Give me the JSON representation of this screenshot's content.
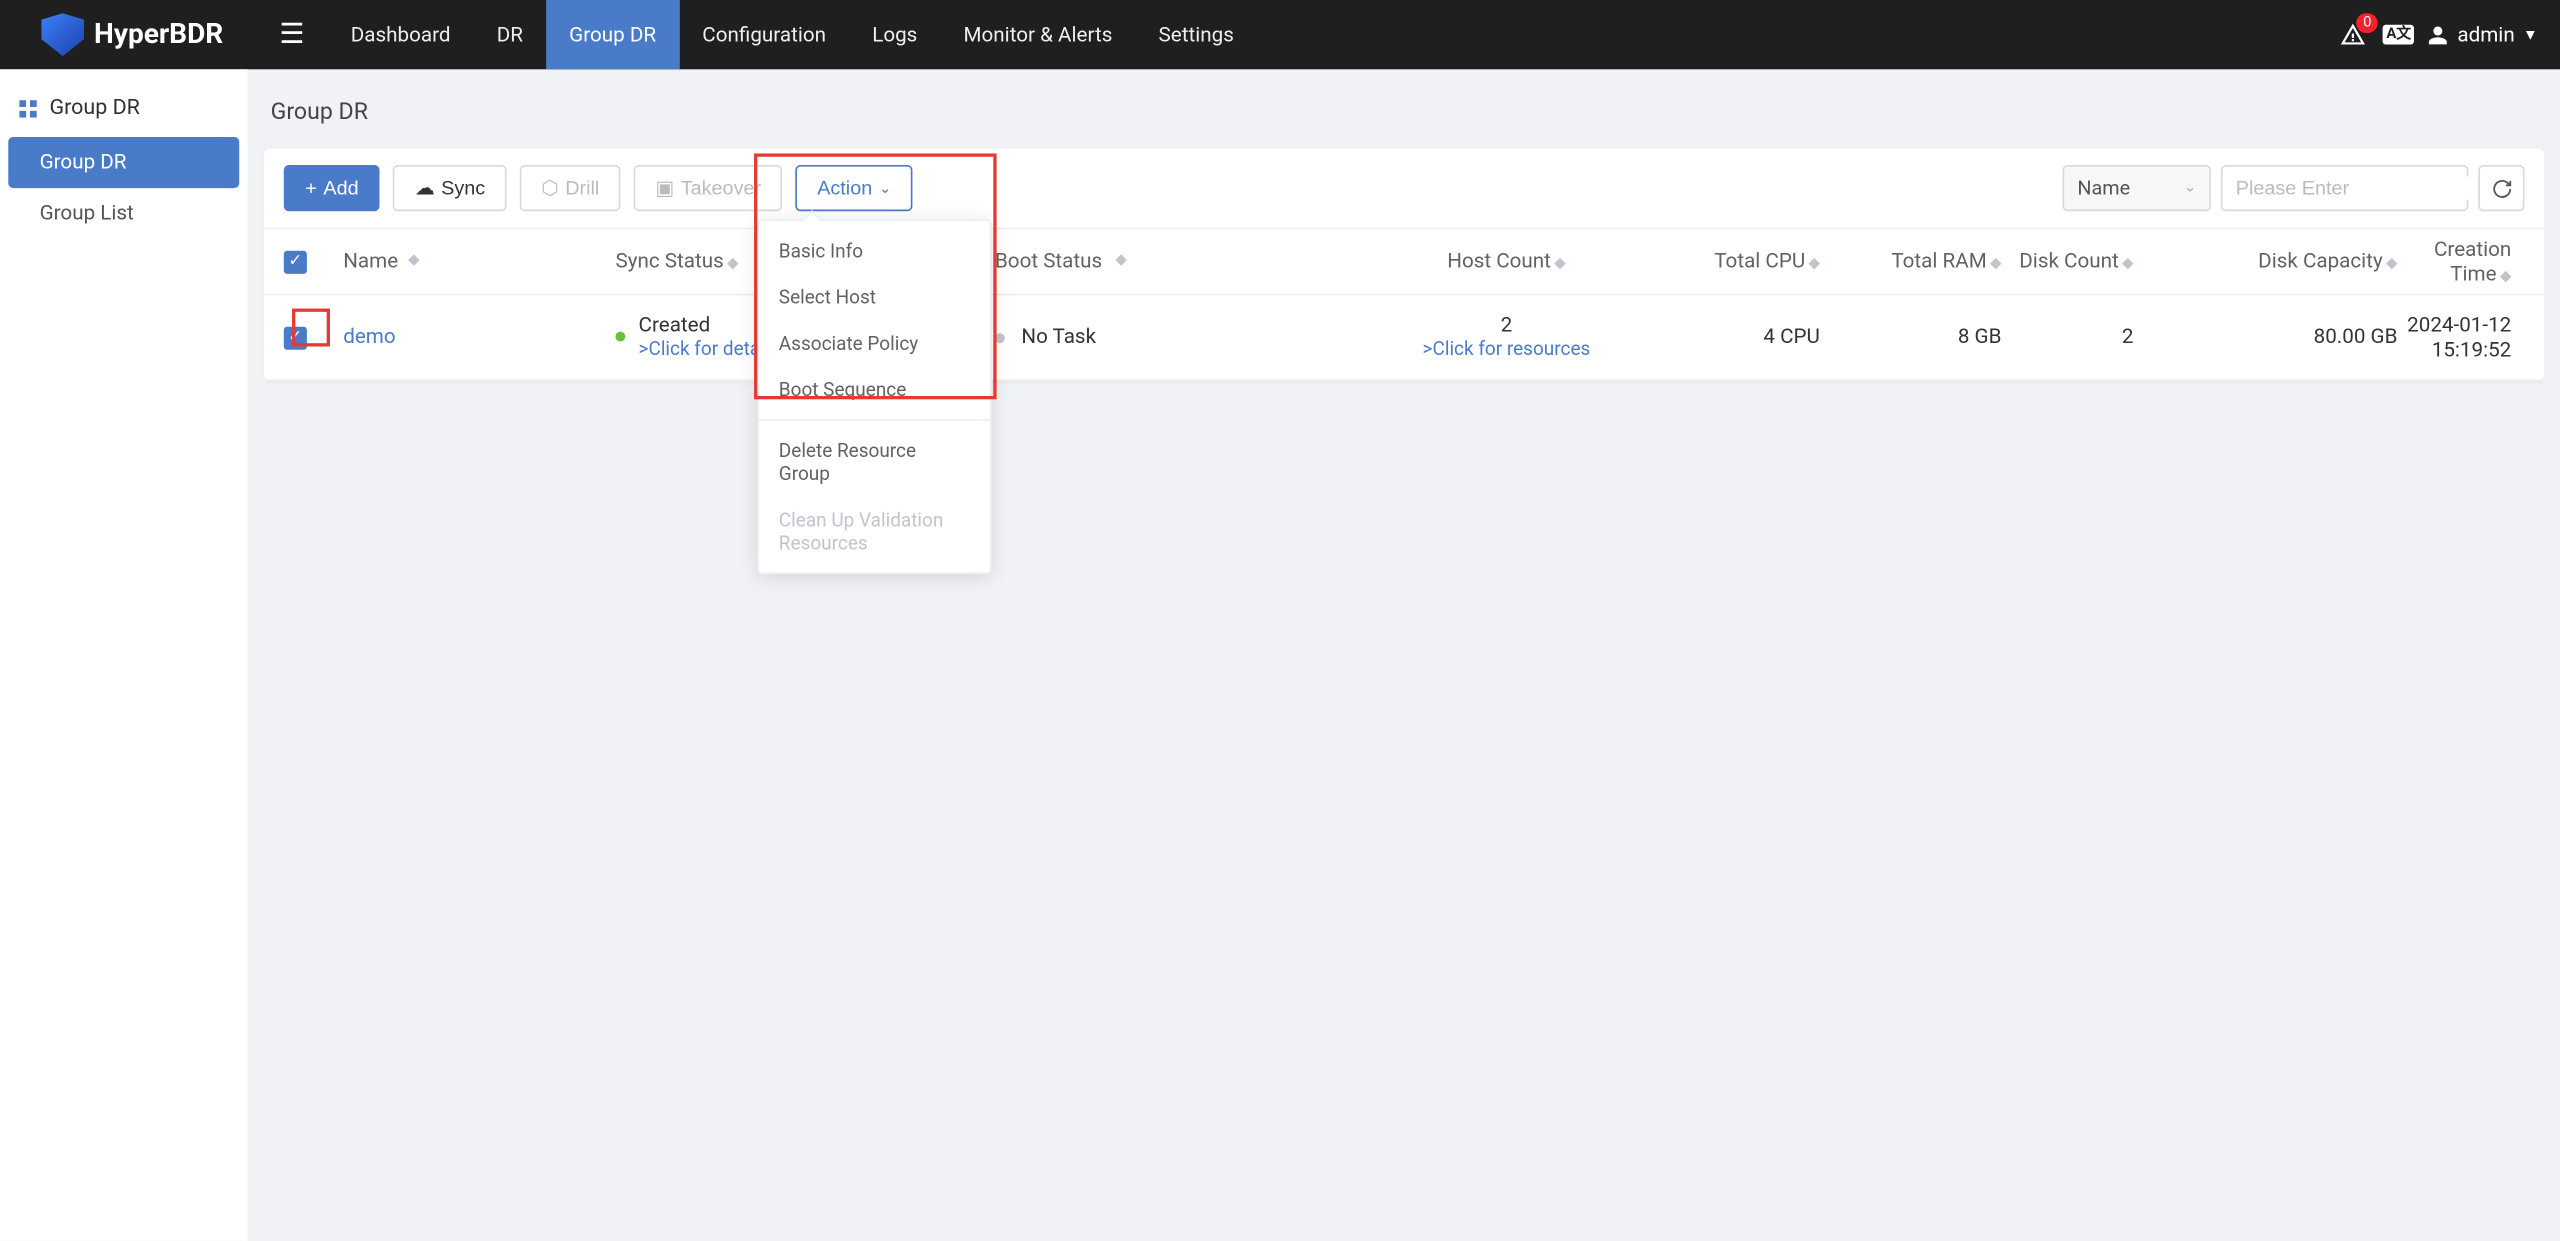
{
  "brand": "HyperBDR",
  "nav": {
    "items": [
      "Dashboard",
      "DR",
      "Group DR",
      "Configuration",
      "Logs",
      "Monitor & Alerts",
      "Settings"
    ],
    "active_index": 2
  },
  "topright": {
    "alert_count": "0",
    "lang": "A文",
    "user": "admin"
  },
  "sidebar": {
    "header": "Group DR",
    "items": [
      "Group DR",
      "Group List"
    ],
    "active_index": 0
  },
  "page": {
    "title": "Group DR"
  },
  "toolbar": {
    "add": "Add",
    "sync": "Sync",
    "drill": "Drill",
    "takeover": "Takeover",
    "action": "Action",
    "filter_label": "Name",
    "search_placeholder": "Please Enter"
  },
  "action_menu": {
    "items": [
      {
        "label": "Basic Info",
        "disabled": false
      },
      {
        "label": "Select Host",
        "disabled": false
      },
      {
        "label": "Associate Policy",
        "disabled": false
      },
      {
        "label": "Boot Sequence",
        "disabled": false
      }
    ],
    "below": [
      {
        "label": "Delete Resource Group",
        "disabled": false
      },
      {
        "label": "Clean Up Validation Resources",
        "disabled": true
      }
    ]
  },
  "table": {
    "columns": [
      "Name",
      "Sync Status",
      "Boot Status",
      "Host Count",
      "Total CPU",
      "Total RAM",
      "Disk Count",
      "Disk Capacity",
      "Creation Time"
    ],
    "rows": [
      {
        "name": "demo",
        "sync_status": "Created",
        "sync_detail": ">Click for details",
        "boot_status": "No Task",
        "host_count": "2",
        "host_detail": ">Click for resources",
        "total_cpu": "4 CPU",
        "total_ram": "8 GB",
        "disk_count": "2",
        "disk_capacity": "80.00 GB",
        "creation_time": "2024-01-12 15:19:52"
      }
    ]
  }
}
